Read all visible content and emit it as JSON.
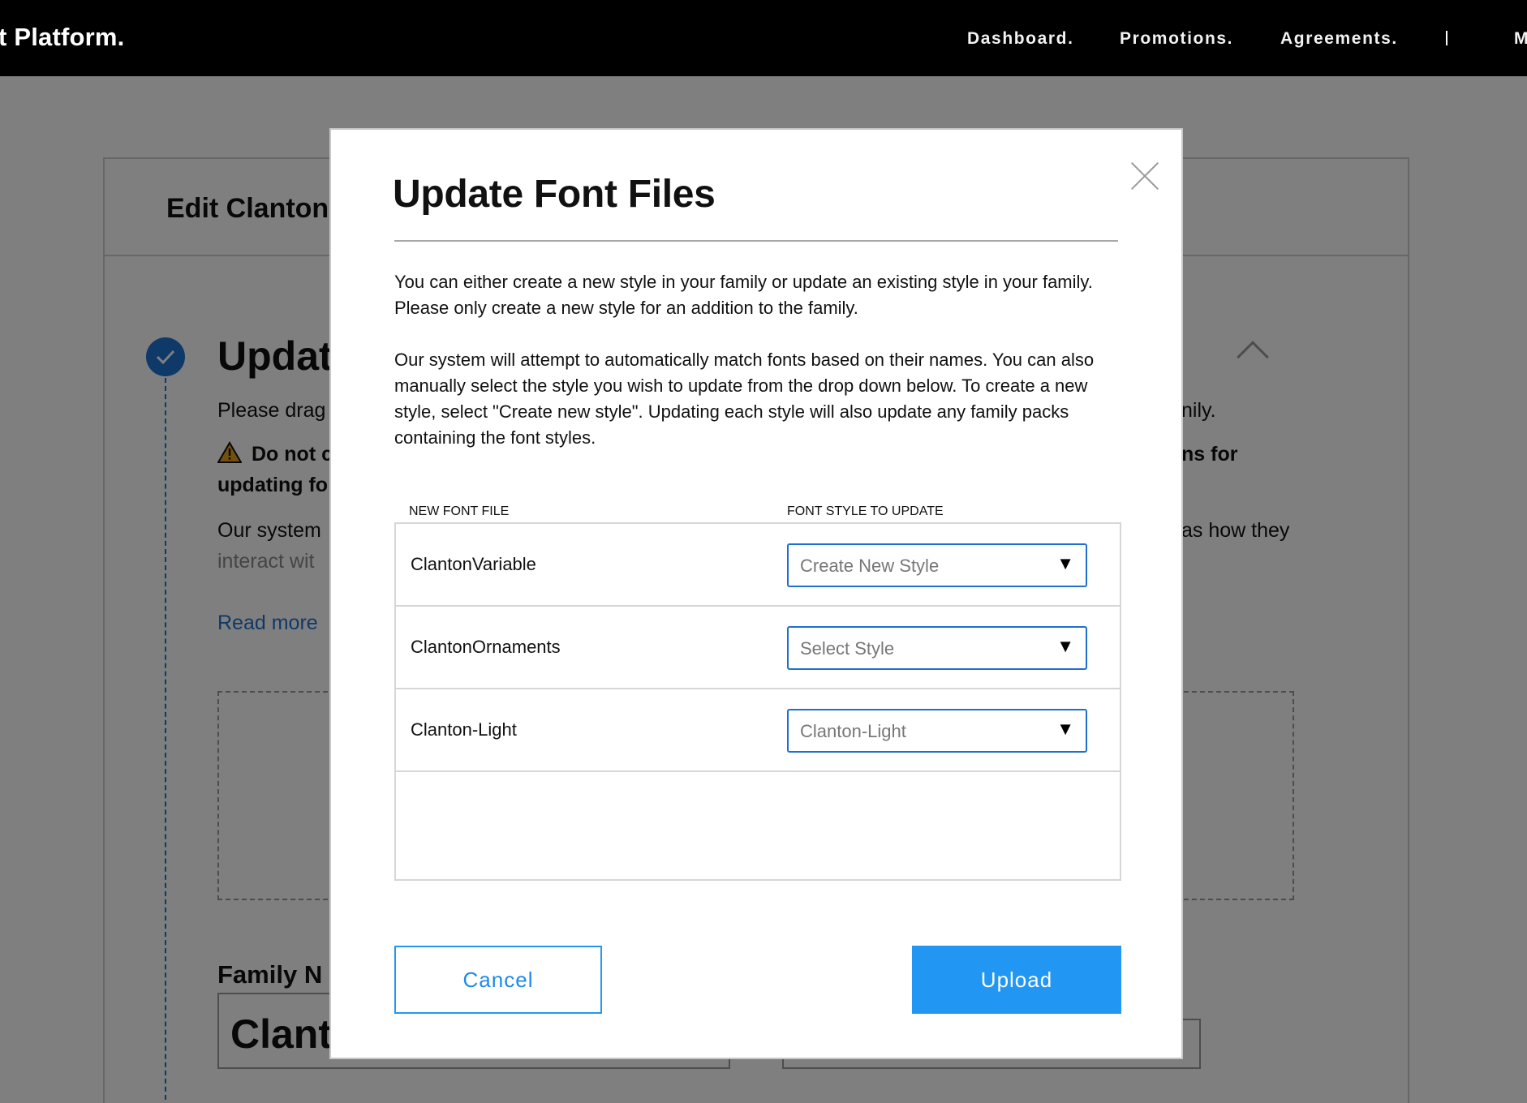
{
  "app": {
    "brand": "t Platform.",
    "nav": [
      "Dashboard.",
      "Promotions.",
      "Agreements.",
      "M"
    ]
  },
  "background": {
    "card_title": "Edit Clanton",
    "section_title": "Updat",
    "line1_left": "Please drag",
    "line1_right": "nily.",
    "warning_left": "Do not c",
    "warning_right": "ns for",
    "warning_line2": "updating fo",
    "line3_left": "Our system",
    "line3_right": "as how they",
    "line4_left": "interact wit",
    "read_more": "Read more",
    "family_label": "Family N",
    "family_value": "Clant"
  },
  "modal": {
    "title": "Update Font Files",
    "paragraph1": "You can either create a new style in your family or update an existing style in your family. Please only create a new style for an addition to the family.",
    "paragraph2": "Our system will attempt to automatically match fonts based on their names. You can also manually select the style you wish to update from the drop down below. To create a new style, select \"Create new style\". Updating each style will also update any family packs containing the font styles.",
    "col_new_file": "NEW FONT FILE",
    "col_style": "FONT STYLE TO UPDATE",
    "rows": [
      {
        "file": "ClantonVariable",
        "style": "Create New Style"
      },
      {
        "file": "ClantonOrnaments",
        "style": "Select Style"
      },
      {
        "file": "Clanton-Light",
        "style": "Clanton-Light"
      }
    ],
    "dropdown_arrow": "▼",
    "cancel_label": "Cancel",
    "upload_label": "Upload"
  },
  "colors": {
    "accent": "#2196f3",
    "select_border": "#1f6fd1",
    "topbar": "#000000"
  }
}
